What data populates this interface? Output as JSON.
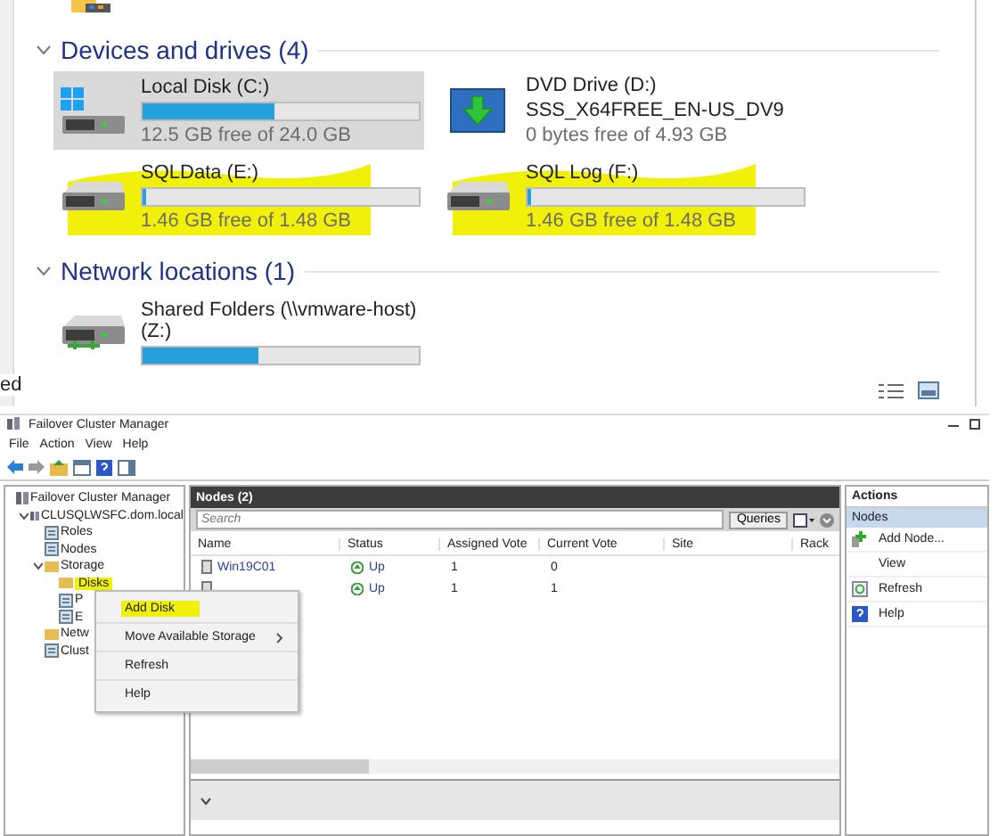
{
  "explorer": {
    "sections": [
      {
        "title": "Devices and drives (4)",
        "expanded": true,
        "drives": [
          {
            "kind": "system",
            "name": "Local Disk (C:)",
            "free": "12.5 GB free of 24.0 GB",
            "level": 0.48,
            "selected": true,
            "highlighted": false
          },
          {
            "kind": "dvd",
            "name": "DVD Drive (D:)",
            "label": "SSS_X64FREE_EN-US_DV9",
            "free": "0 bytes free of 4.93 GB",
            "selected": false,
            "highlighted": false
          },
          {
            "kind": "disk",
            "name": "SQLData (E:)",
            "free": "1.46 GB free of 1.48 GB",
            "level": 0.01,
            "selected": false,
            "highlighted": true
          },
          {
            "kind": "disk",
            "name": "SQL Log (F:)",
            "free": "1.46 GB free of 1.48 GB",
            "level": 0.01,
            "selected": false,
            "highlighted": true
          }
        ]
      },
      {
        "title": "Network locations (1)",
        "expanded": true,
        "drives": [
          {
            "kind": "network",
            "name": "Shared Folders (\\\\vmware-host) (Z:)",
            "level": 0.42,
            "selected": false,
            "highlighted": false
          }
        ]
      }
    ],
    "status_fragment": "ed"
  },
  "cluster": {
    "window": {
      "title": "Failover Cluster Manager"
    },
    "menu": [
      "File",
      "Action",
      "View",
      "Help"
    ],
    "tree": [
      {
        "label": "Failover Cluster Manager",
        "kind": "cluster",
        "highlighted": false,
        "children": [
          {
            "label": "CLUSQLWSFC.dom.local",
            "kind": "cluster",
            "expanded": true,
            "highlighted": false,
            "children": [
              {
                "label": "Roles",
                "kind": "roles",
                "highlighted": false
              },
              {
                "label": "Nodes",
                "kind": "nodes",
                "highlighted": false
              },
              {
                "label": "Storage",
                "kind": "folder",
                "expanded": true,
                "highlighted": false,
                "children": [
                  {
                    "label": "Disks",
                    "kind": "disks",
                    "highlighted": true
                  },
                  {
                    "label": "P",
                    "kind": "pools",
                    "highlighted": false
                  },
                  {
                    "label": "E",
                    "kind": "enclosures",
                    "highlighted": false
                  }
                ]
              },
              {
                "label": "Netw",
                "kind": "folder",
                "highlighted": false
              },
              {
                "label": "Clust",
                "kind": "events",
                "highlighted": false
              }
            ]
          }
        ]
      }
    ],
    "nodes_panel": {
      "title": "Nodes (2)",
      "search": {
        "placeholder": "Search"
      },
      "queries": "Queries",
      "columns": [
        "Name",
        "Status",
        "Assigned Vote",
        "Current Vote",
        "Site",
        "Rack"
      ],
      "rows": [
        {
          "name": "Win19C01",
          "status": "Up",
          "assigned_vote": "1",
          "current_vote": "0"
        },
        {
          "status": "Up",
          "assigned_vote": "1",
          "current_vote": "1"
        }
      ]
    },
    "actions": {
      "title": "Actions",
      "sections": [
        {
          "title": "Nodes",
          "selected": true,
          "items": [
            {
              "label": "Add Node...",
              "kind": "add"
            },
            {
              "label": "View",
              "kind": "submenu"
            },
            {
              "label": "Refresh",
              "kind": "refresh"
            },
            {
              "label": "Help",
              "kind": "help"
            }
          ]
        }
      ]
    },
    "context_menu": [
      {
        "label": "Add Disk",
        "highlighted": true,
        "submenu": false
      },
      {
        "label": "Move Available Storage",
        "highlighted": false,
        "submenu": true
      },
      {
        "label": "Refresh",
        "highlighted": false,
        "submenu": false
      },
      {
        "label": "Help",
        "highlighted": false,
        "submenu": false
      }
    ]
  }
}
